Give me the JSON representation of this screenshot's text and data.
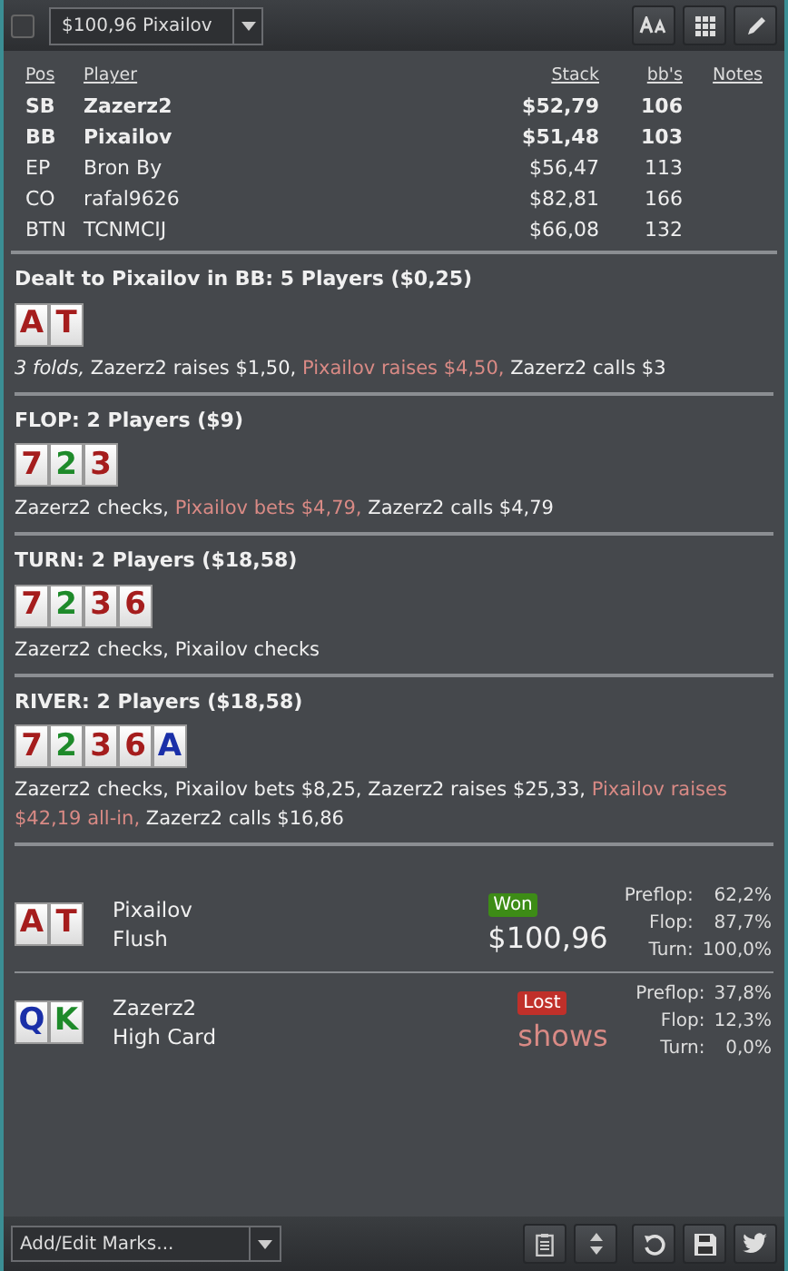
{
  "toolbar": {
    "checked": false,
    "hand_select": "$100,96 Pixailov",
    "buttons": [
      {
        "kind": "font"
      },
      {
        "kind": "grid"
      },
      {
        "kind": "pen"
      }
    ]
  },
  "players": {
    "columns": [
      "Pos",
      "Player",
      "Stack",
      "bb's",
      "Notes"
    ],
    "rows": [
      {
        "pos": "SB",
        "player": "Zazerz2",
        "stack": "$52,79",
        "bbs": "106",
        "in_hand": true
      },
      {
        "pos": "BB",
        "player": "Pixailov",
        "stack": "$51,48",
        "bbs": "103",
        "in_hand": true
      },
      {
        "pos": "EP",
        "player": "Bron By",
        "stack": "$56,47",
        "bbs": "113",
        "in_hand": false
      },
      {
        "pos": "CO",
        "player": "rafal9626",
        "stack": "$82,81",
        "bbs": "166",
        "in_hand": false
      },
      {
        "pos": "BTN",
        "player": "TCNMCIJ",
        "stack": "$66,08",
        "bbs": "132",
        "in_hand": false
      }
    ]
  },
  "streets": [
    {
      "title": "Dealt to Pixailov in BB: 5 Players ($0,25)",
      "cards": [
        {
          "rank": "A",
          "color": "#a51d1d"
        },
        {
          "rank": "T",
          "color": "#a51d1d"
        }
      ],
      "actions": [
        {
          "text": "3 folds,",
          "kind": "fold"
        },
        {
          "text": "Zazerz2 raises $1,50,",
          "kind": "plain"
        },
        {
          "text": "Pixailov raises $4,50,",
          "kind": "hero"
        },
        {
          "text": "Zazerz2 calls $3",
          "kind": "plain"
        }
      ]
    },
    {
      "title": "FLOP: 2 Players ($9)",
      "cards": [
        {
          "rank": "7",
          "color": "#a51d1d"
        },
        {
          "rank": "2",
          "color": "#1e8a2a"
        },
        {
          "rank": "3",
          "color": "#a51d1d"
        }
      ],
      "actions": [
        {
          "text": "Zazerz2 checks,",
          "kind": "plain"
        },
        {
          "text": "Pixailov bets $4,79,",
          "kind": "hero"
        },
        {
          "text": "Zazerz2 calls $4,79",
          "kind": "plain"
        }
      ]
    },
    {
      "title": "TURN: 2 Players ($18,58)",
      "cards": [
        {
          "rank": "7",
          "color": "#a51d1d"
        },
        {
          "rank": "2",
          "color": "#1e8a2a"
        },
        {
          "rank": "3",
          "color": "#a51d1d"
        },
        {
          "rank": "6",
          "color": "#a51d1d"
        }
      ],
      "actions": [
        {
          "text": "Zazerz2 checks, Pixailov checks",
          "kind": "plain"
        }
      ]
    },
    {
      "title": "RIVER: 2 Players ($18,58)",
      "cards": [
        {
          "rank": "7",
          "color": "#a51d1d"
        },
        {
          "rank": "2",
          "color": "#1e8a2a"
        },
        {
          "rank": "3",
          "color": "#a51d1d"
        },
        {
          "rank": "6",
          "color": "#a51d1d"
        },
        {
          "rank": "A",
          "color": "#1a2fa8"
        }
      ],
      "actions": [
        {
          "text": "Zazerz2 checks, Pixailov bets $8,25, Zazerz2 raises $25,33,",
          "kind": "plain"
        },
        {
          "text": "Pixailov raises $42,19 all-in,",
          "kind": "hero"
        },
        {
          "text": "Zazerz2 calls $16,86",
          "kind": "plain"
        }
      ]
    }
  ],
  "results": [
    {
      "cards": [
        {
          "rank": "A",
          "color": "#a51d1d"
        },
        {
          "rank": "T",
          "color": "#a51d1d"
        }
      ],
      "player": "Pixailov",
      "hand": "Flush",
      "kind": "won",
      "badge": "Won",
      "amount": "$100,96",
      "equity": [
        {
          "label": "Preflop:",
          "value": "62,2%"
        },
        {
          "label": "Flop:",
          "value": "87,7%"
        },
        {
          "label": "Turn:",
          "value": "100,0%"
        }
      ]
    },
    {
      "cards": [
        {
          "rank": "Q",
          "color": "#1a2fa8"
        },
        {
          "rank": "K",
          "color": "#1e8a2a"
        }
      ],
      "player": "Zazerz2",
      "hand": "High Card",
      "kind": "lost",
      "badge": "Lost",
      "amount": "shows",
      "equity": [
        {
          "label": "Preflop:",
          "value": "37,8%"
        },
        {
          "label": "Flop:",
          "value": "12,3%"
        },
        {
          "label": "Turn:",
          "value": "0,0%"
        }
      ]
    }
  ],
  "bottom": {
    "marks_placeholder": "Add/Edit Marks...",
    "buttons": [
      {
        "kind": "clipboard"
      },
      {
        "kind": "updown"
      },
      {
        "kind": "refresh"
      },
      {
        "kind": "save"
      },
      {
        "kind": "bird"
      }
    ]
  }
}
